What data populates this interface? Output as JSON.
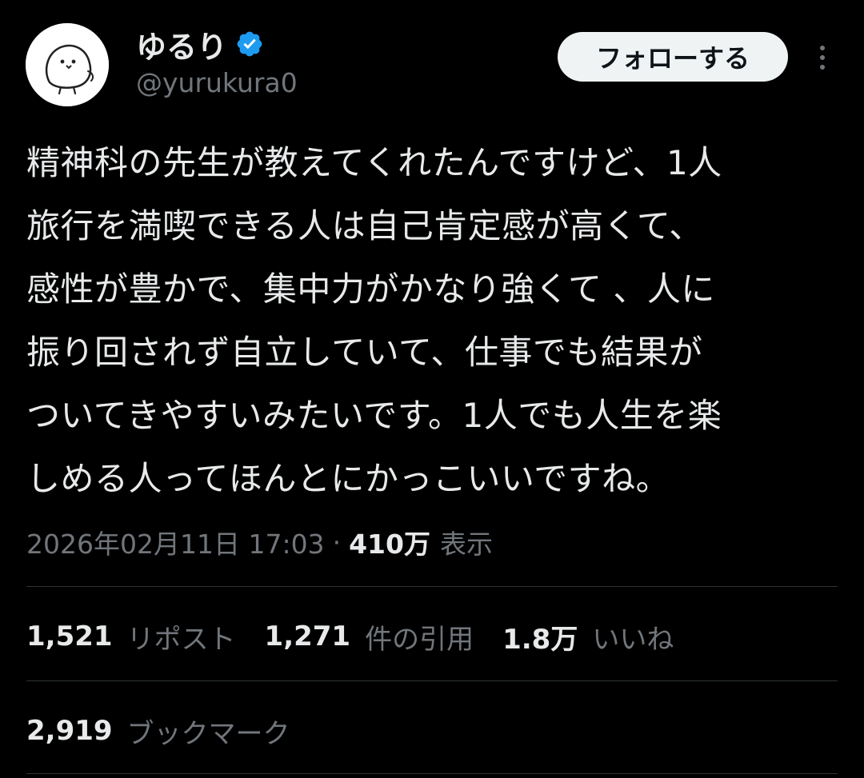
{
  "author": {
    "display_name": "ゆるり",
    "handle": "@yurukura0",
    "verified": true,
    "verified_color": "#1d9bf0",
    "avatar_icon": "bird-doodle-icon"
  },
  "follow_button": {
    "label": "フォローする"
  },
  "more_icon": "more-vertical-icon",
  "tweet": {
    "text": "精神科の先生が教えてくれたんですけど、1人\n旅行を満喫できる人は自己肯定感が高くて、\n感性が豊かで、集中力がかなり強くて 、人に\n振り回されず自立していて、仕事でも結果が\nついてきやすいみたいです。1人でも人生を楽\nしめる人ってほんとにかっこいいですね。"
  },
  "meta": {
    "timestamp": "2026年02月11日 17:03",
    "separator": "·",
    "views_count": "410万",
    "views_label": "表示"
  },
  "stats": {
    "reposts": {
      "count": "1,521",
      "label": "リポスト"
    },
    "quotes": {
      "count": "1,271",
      "label": "件の引用"
    },
    "likes": {
      "count": "1.8万",
      "label": "いいね"
    },
    "bookmarks": {
      "count": "2,919",
      "label": "ブックマーク"
    }
  },
  "colors": {
    "background": "#000000",
    "text": "#e7e9ea",
    "secondary_text": "#71767b",
    "divider": "#2f3336",
    "button_bg": "#eff3f4",
    "button_text": "#0f1419"
  }
}
